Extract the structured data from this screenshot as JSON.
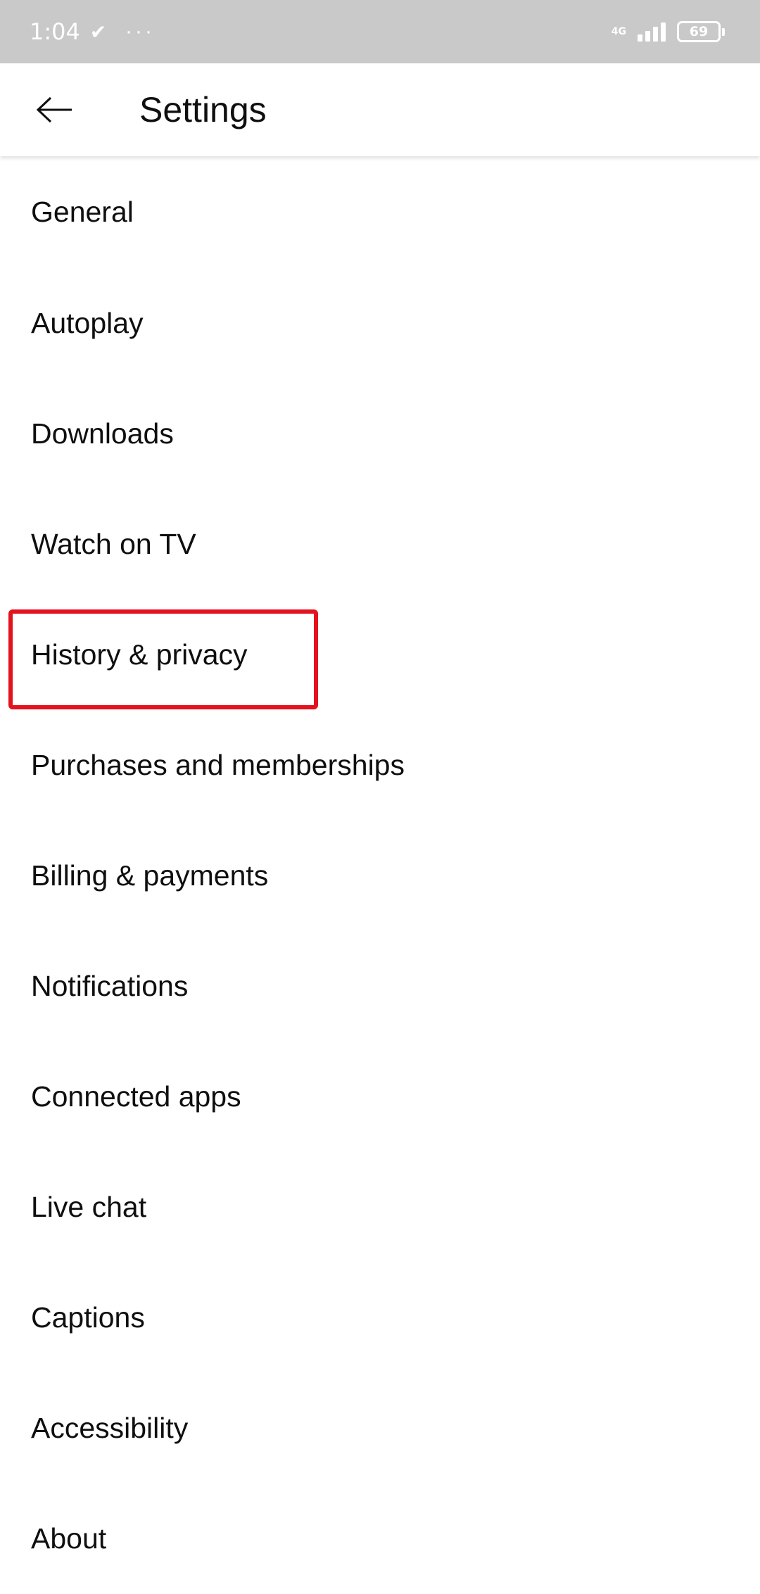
{
  "status_bar": {
    "time": "1:04",
    "check_icon": "✔",
    "dots": "···",
    "network_type": "4G",
    "battery_level": "69"
  },
  "app_bar": {
    "back_icon": "arrow-left-icon",
    "title": "Settings"
  },
  "settings": {
    "items": [
      {
        "label": "General"
      },
      {
        "label": "Autoplay"
      },
      {
        "label": "Downloads"
      },
      {
        "label": "Watch on TV"
      },
      {
        "label": "History & privacy"
      },
      {
        "label": "Purchases and memberships"
      },
      {
        "label": "Billing & payments"
      },
      {
        "label": "Notifications"
      },
      {
        "label": "Connected apps"
      },
      {
        "label": "Live chat"
      },
      {
        "label": "Captions"
      },
      {
        "label": "Accessibility"
      },
      {
        "label": "About"
      }
    ]
  },
  "highlight": {
    "target": "History & privacy",
    "color": "#e4121e"
  },
  "colors": {
    "status_bar_bg": "#c9c9c9",
    "text": "#0f0f0f",
    "background": "#ffffff"
  }
}
